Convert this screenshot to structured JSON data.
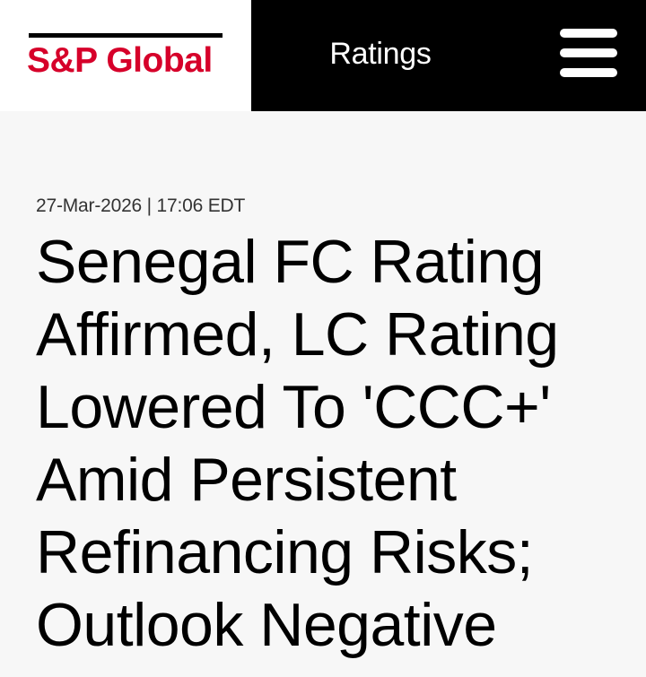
{
  "header": {
    "logo_text": "S&P Global",
    "section_title": "Ratings",
    "menu_icon": "hamburger-menu-icon",
    "brand_color": "#d6002a"
  },
  "article": {
    "dateline": "27-Mar-2026 | 17:06 EDT",
    "headline": "Senegal FC Rating Affirmed, LC Rating Lowered To 'CCC+' Amid Persistent Refinancing Risks; Outlook Negative"
  }
}
